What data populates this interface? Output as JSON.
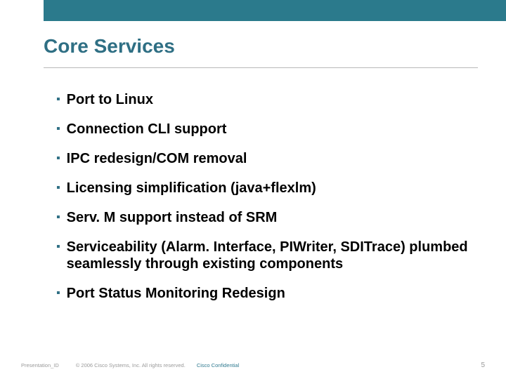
{
  "title": "Core Services",
  "bullets": [
    "Port to Linux",
    "Connection CLI support",
    "IPC redesign/COM removal",
    "Licensing simplification (java+flexlm)",
    "Serv. M support instead of SRM",
    "Serviceability (Alarm. Interface, PIWriter, SDITrace) plumbed seamlessly through existing components",
    "Port Status Monitoring Redesign"
  ],
  "footer": {
    "presentation_id": "Presentation_ID",
    "copyright": "© 2006 Cisco Systems, Inc. All rights reserved.",
    "confidential": "Cisco Confidential",
    "page_num": "5"
  }
}
